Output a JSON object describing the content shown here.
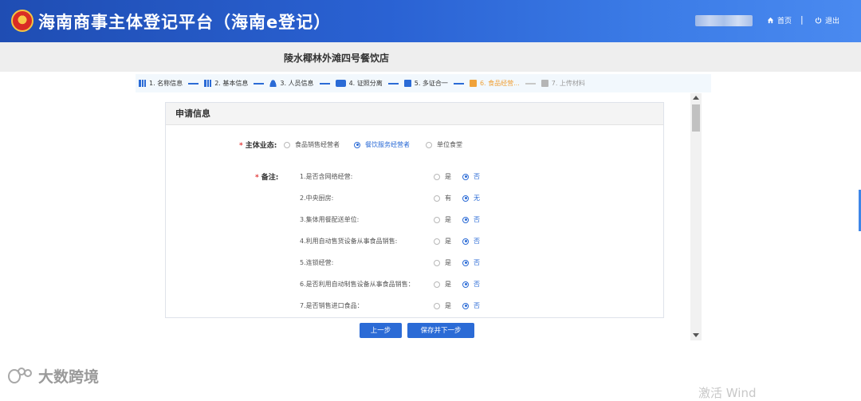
{
  "header": {
    "title": "海南商事主体登记平台（海南e登记）",
    "home_label": "首页",
    "separator": "|",
    "logout_label": "退出",
    "home_icon": "home-icon",
    "logout_icon": "power-icon"
  },
  "subbar": {
    "shop_name": "陵水椰林外滩四号餐饮店"
  },
  "steps": [
    {
      "label": "1. 名称信息",
      "state": "done",
      "icon": "bar-chart-icon"
    },
    {
      "label": "2. 基本信息",
      "state": "done",
      "icon": "bar-chart-icon"
    },
    {
      "label": "3. 人员信息",
      "state": "done",
      "icon": "person-icon"
    },
    {
      "label": "4. 证照分离",
      "state": "done",
      "icon": "id-card-icon"
    },
    {
      "label": "5. 多证合一",
      "state": "done",
      "icon": "document-icon"
    },
    {
      "label": "6. 食品经营...",
      "state": "active",
      "icon": "food-license-icon"
    },
    {
      "label": "7. 上传材料",
      "state": "pending",
      "icon": "upload-icon"
    }
  ],
  "panel": {
    "title": "申请信息",
    "business_type": {
      "required_mark": "*",
      "label": "主体业态:",
      "options": [
        {
          "label": "食品销售经营者",
          "selected": false
        },
        {
          "label": "餐饮服务经营者",
          "selected": true
        },
        {
          "label": "单位食堂",
          "selected": false
        }
      ]
    },
    "remarks": {
      "required_mark": "*",
      "label": "备注:",
      "questions": [
        {
          "text": "1.是否含网络经营:",
          "yes": "是",
          "no": "否",
          "selected": "no"
        },
        {
          "text": "2.中央厨房:",
          "yes": "有",
          "no": "无",
          "selected": "no"
        },
        {
          "text": "3.集体用餐配送单位:",
          "yes": "是",
          "no": "否",
          "selected": "no"
        },
        {
          "text": "4.利用自动售货设备从事食品销售:",
          "yes": "是",
          "no": "否",
          "selected": "no"
        },
        {
          "text": "5.连锁经营:",
          "yes": "是",
          "no": "否",
          "selected": "no"
        },
        {
          "text": "6.是否利用自动制售设备从事食品销售：",
          "yes": "是",
          "no": "否",
          "selected": "no"
        },
        {
          "text": "7.是否销售进口食品：",
          "yes": "是",
          "no": "否",
          "selected": "no"
        }
      ]
    }
  },
  "buttons": {
    "prev": "上一步",
    "next": "保存并下一步"
  },
  "watermark": {
    "text": "大数跨境"
  },
  "os_overlay": {
    "text": "激活 Wind"
  },
  "colors": {
    "primary": "#2b6bd6",
    "active_step": "#f0a23a",
    "required": "#e23c3c"
  }
}
